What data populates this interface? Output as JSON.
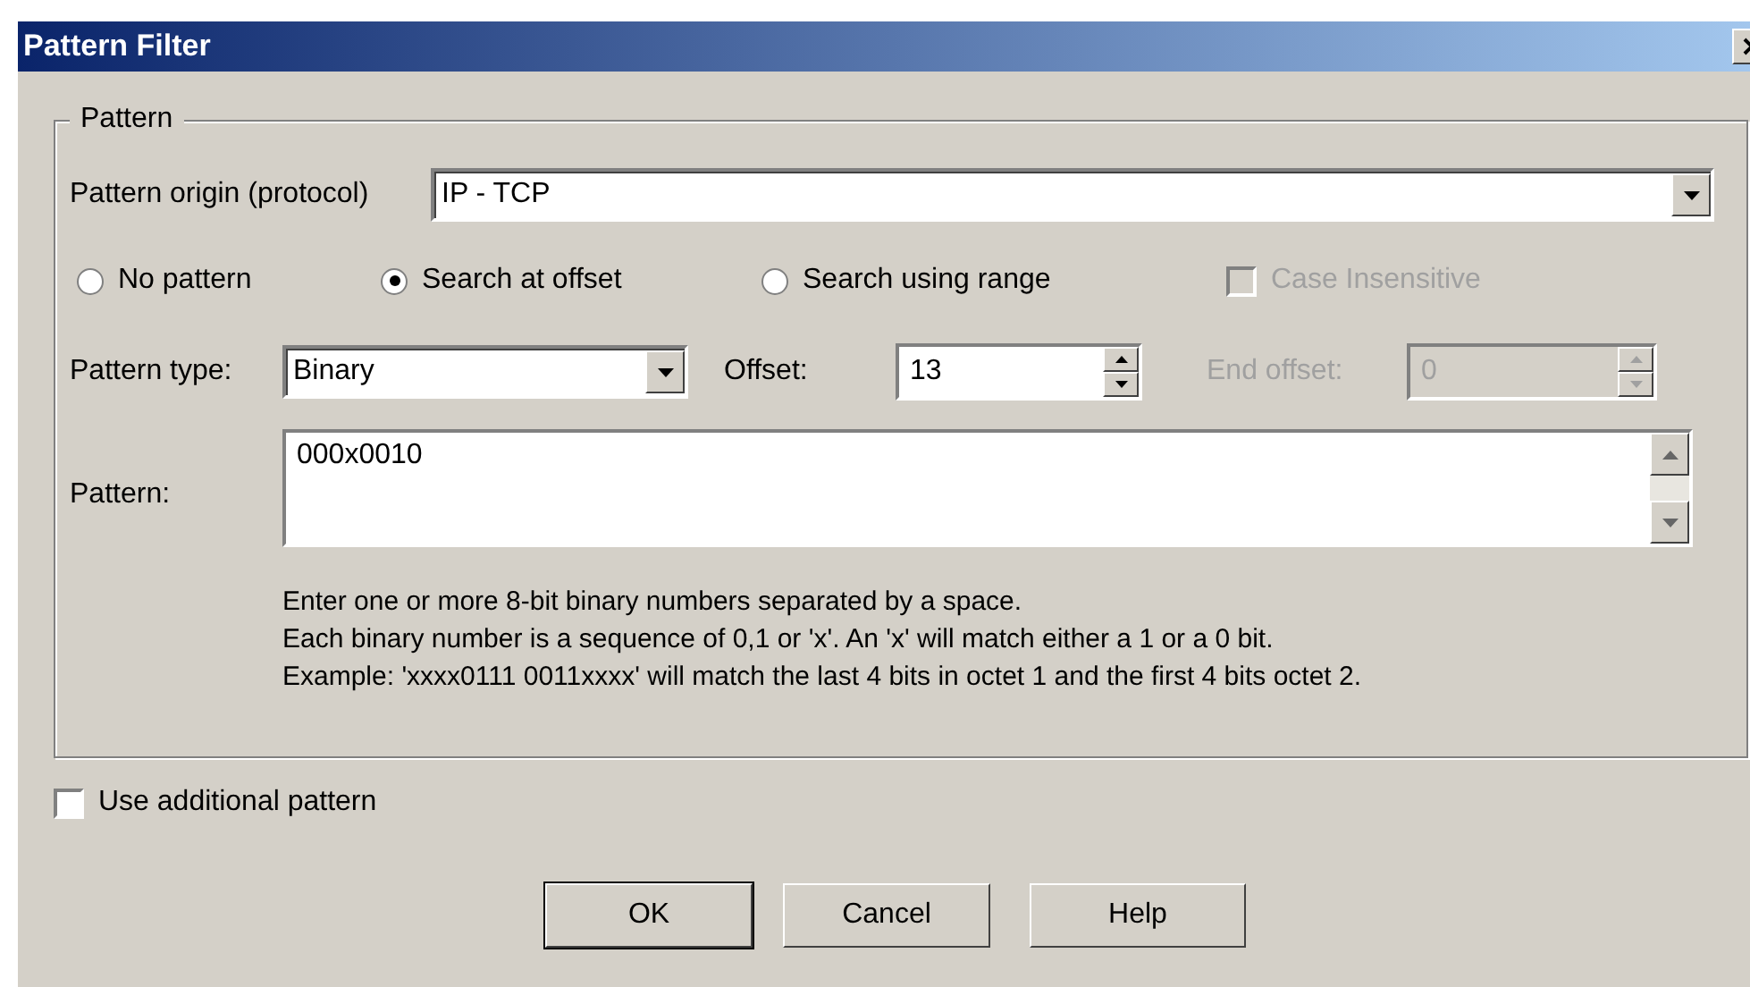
{
  "window": {
    "title": "Pattern Filter"
  },
  "pattern_group": {
    "legend": "Pattern",
    "origin": {
      "label": "Pattern origin (protocol)",
      "value": "IP - TCP"
    },
    "modes": [
      {
        "label": "No pattern",
        "selected": false
      },
      {
        "label": "Search at offset",
        "selected": true
      },
      {
        "label": "Search using range",
        "selected": false
      }
    ],
    "case_insensitive": {
      "label": "Case Insensitive",
      "checked": false,
      "disabled": true
    },
    "pattern_type": {
      "label": "Pattern type:",
      "value": "Binary"
    },
    "offset": {
      "label": "Offset:",
      "value": "13",
      "disabled": false
    },
    "end_offset": {
      "label": "End offset:",
      "value": "0",
      "disabled": true
    },
    "pattern": {
      "label": "Pattern:",
      "value": "000x0010"
    },
    "help": [
      "Enter one or more 8-bit binary numbers separated by a space.",
      "Each binary number is a sequence of 0,1 or 'x'. An 'x' will match either a 1 or a 0 bit.",
      "Example: 'xxxx0111 0011xxxx' will match the last 4 bits in octet 1 and the first 4 bits octet 2."
    ]
  },
  "use_additional": {
    "label": "Use additional pattern",
    "checked": false
  },
  "buttons": [
    {
      "label": "OK",
      "default": true
    },
    {
      "label": "Cancel",
      "default": false
    },
    {
      "label": "Help",
      "default": false
    }
  ]
}
